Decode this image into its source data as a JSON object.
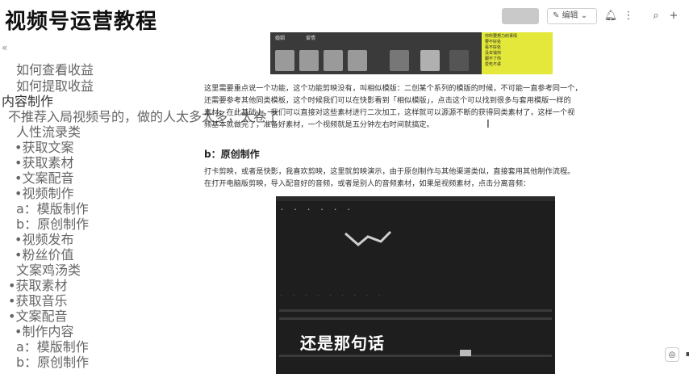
{
  "header": {
    "title": "视频号运营教程",
    "grey_button": "",
    "edit_button": "编辑",
    "icons": [
      "bell-icon",
      "search-icon",
      "plus-icon"
    ]
  },
  "sidebar": {
    "collapse_icon": "«",
    "items": [
      {
        "label": "如何查看收益"
      },
      {
        "label": "如何提取收益"
      },
      {
        "label": "内容制作"
      },
      {
        "label": "不推荐入局视频号的，做的人太多太多，太卷了"
      },
      {
        "label": "人性流录类"
      },
      {
        "label": "•获取文案"
      },
      {
        "label": "•获取素材"
      },
      {
        "label": "•文案配音"
      },
      {
        "label": "•视频制作"
      },
      {
        "label": "a：模版制作"
      },
      {
        "label": "b：原创制作"
      },
      {
        "label": "•视频发布"
      },
      {
        "label": "•粉丝价值"
      },
      {
        "label": "文案鸡汤类"
      },
      {
        "label": "•获取素材"
      },
      {
        "label": "•获取音乐"
      },
      {
        "label": "•文案配音"
      },
      {
        "label": "•制作内容"
      },
      {
        "label": "a：模版制作"
      },
      {
        "label": "b：原创制作"
      }
    ]
  },
  "content": {
    "banner": {
      "word": "婚姻",
      "word2": "爱情",
      "list": [
        "你所要努力的事情",
        "要不好处",
        "看不好处",
        "没本钱你",
        "跟不了你",
        "爱吃不讲"
      ]
    },
    "paragraph1": [
      "这里需要重点说一个功能，这个功能剪映没有，叫相似模版：二创某个系列的模版的时候，不可能一直参考同一个，",
      "还需要参考其他同类模板，这个时候我们可以在快影看到「相似模版」，点击这个可以找到很多与套用模版一样的",
      "素材，在此基础上，我们可以直接对这些素材进行二次加工，这样就可以源源不断的获得同类素材了，这样一个视",
      "频基本就做完了，准备好素材，一个视频就是五分钟左右时间就搞定。"
    ],
    "heading_b": "b：原创制作",
    "paragraph2": [
      "打卡剪映，或者是快影，我喜欢剪映，这里就剪映演示，由于原创制作与其他渠道类似，直接套用其他制作流程。",
      "在打开电脑版剪映，导入配音好的音频，或者是别人的音频素材，如果是视频素材，点击分离音频："
    ],
    "video_caption": "还是那句话"
  },
  "colors": {
    "accent_yellow": "#e3e83a",
    "video_bg": "#1e1e1e"
  }
}
